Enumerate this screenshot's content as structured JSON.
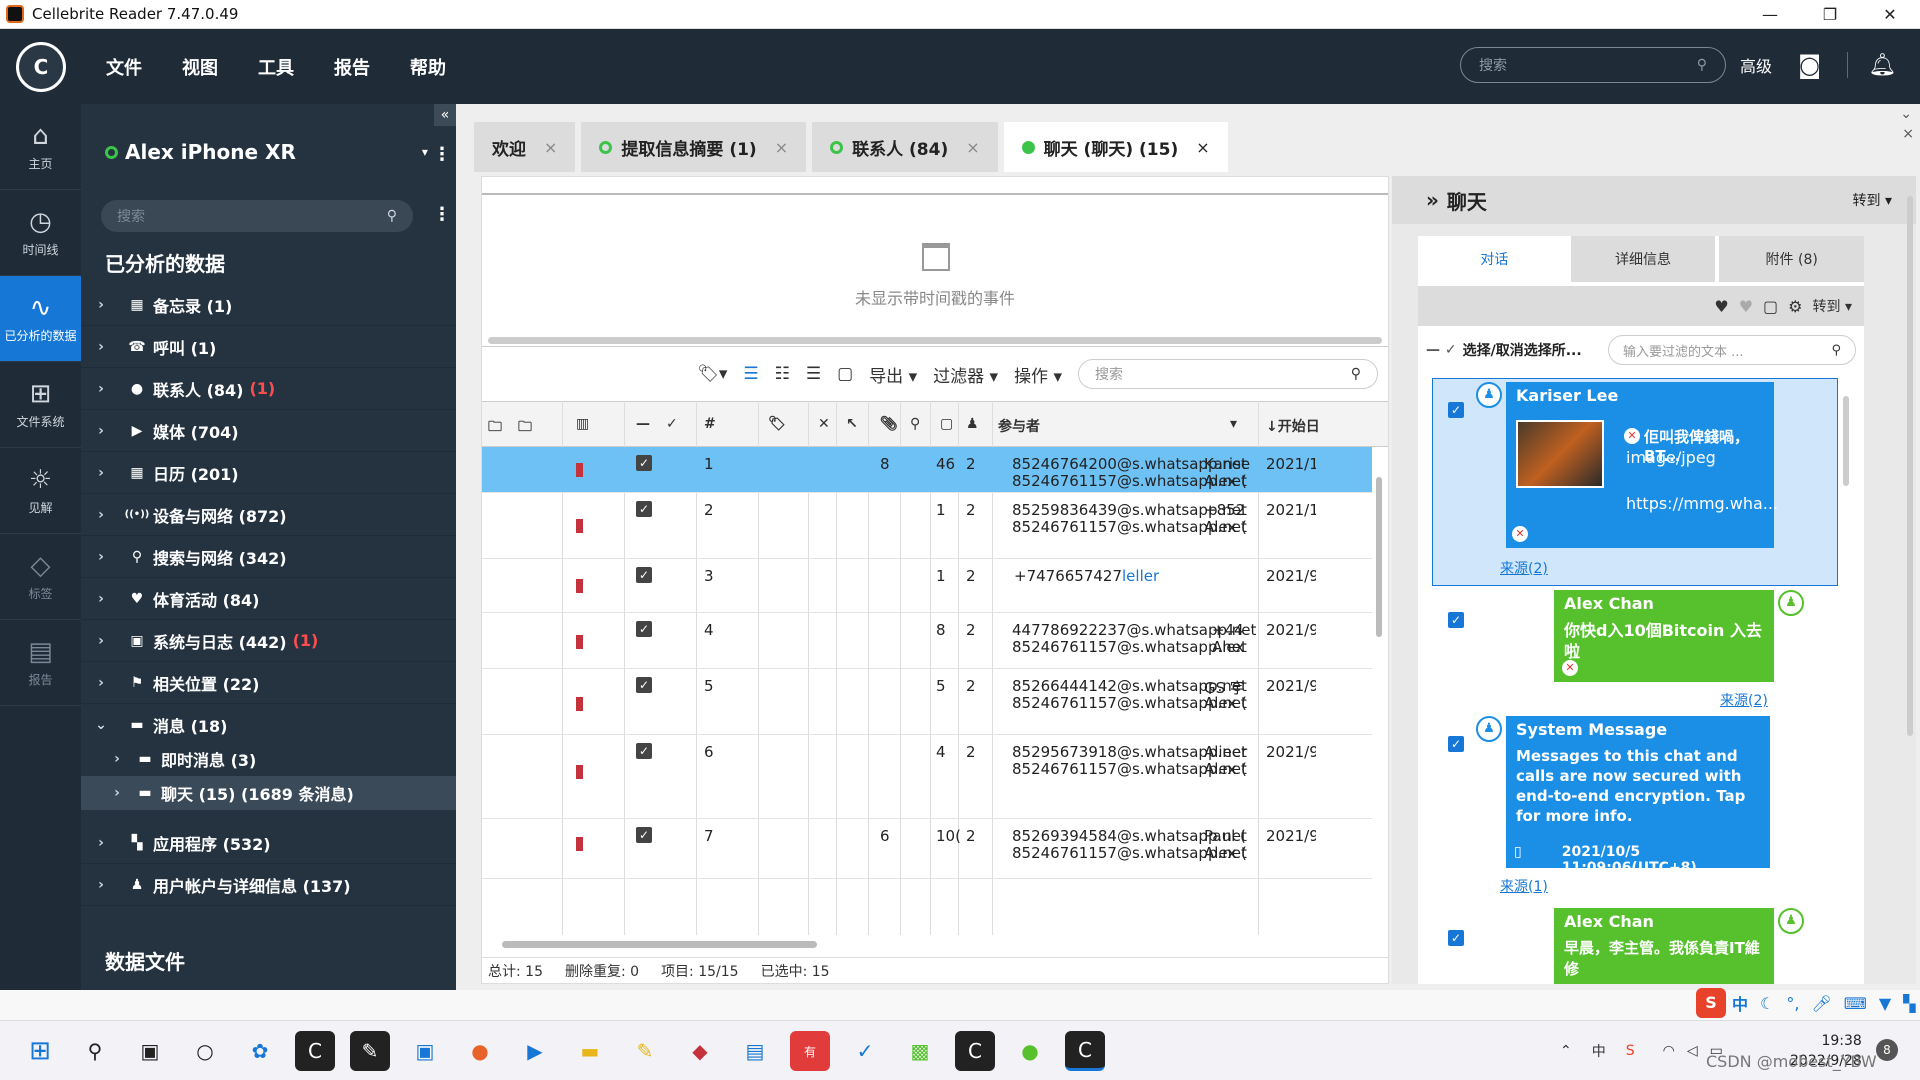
{
  "window": {
    "title": "Cellebrite Reader 7.47.0.49",
    "minimize": "—",
    "restore": "❐",
    "close": "✕"
  },
  "topbar": {
    "logo": "C",
    "menus": [
      "文件",
      "视图",
      "工具",
      "报告",
      "帮助"
    ],
    "search_placeholder": "搜索",
    "advanced": "高级"
  },
  "leftnav": [
    {
      "label": "主页",
      "icon": "⌂"
    },
    {
      "label": "时间线",
      "icon": "◷"
    },
    {
      "label": "已分析的数据",
      "icon": "∿"
    },
    {
      "label": "文件系统",
      "icon": "⊞"
    },
    {
      "label": "见解",
      "icon": "☼"
    },
    {
      "label": "标签",
      "icon": "◇"
    },
    {
      "label": "报告",
      "icon": "▤"
    }
  ],
  "tree": {
    "device": "Alex iPhone XR",
    "search_placeholder": "搜索",
    "section_title": "已分析的数据",
    "section2": "数据文件",
    "items": [
      {
        "label": "备忘录 (1)",
        "icon": "▦",
        "red": ""
      },
      {
        "label": "呼叫 (1)",
        "icon": "☎",
        "red": ""
      },
      {
        "label": "联系人 (84)",
        "icon": "●",
        "red": "(1)"
      },
      {
        "label": "媒体 (704)",
        "icon": "▶",
        "red": ""
      },
      {
        "label": "日历 (201)",
        "icon": "▦",
        "red": ""
      },
      {
        "label": "设备与网络 (872)",
        "icon": "((•))",
        "red": ""
      },
      {
        "label": "搜索与网络 (342)",
        "icon": "⚲",
        "red": ""
      },
      {
        "label": "体育活动 (84)",
        "icon": "♥",
        "red": ""
      },
      {
        "label": "系统与日志 (442)",
        "icon": "▣",
        "red": "(1)"
      },
      {
        "label": "相关位置 (22)",
        "icon": "⚑",
        "red": ""
      },
      {
        "label": "消息 (18)",
        "icon": "▬",
        "red": ""
      },
      {
        "label": "即时消息 (3)",
        "icon": "▬",
        "red": ""
      },
      {
        "label": "聊天 (15)  (1689 条消息)",
        "icon": "▬",
        "red": ""
      },
      {
        "label": "应用程序 (532)",
        "icon": "▚",
        "red": ""
      },
      {
        "label": "用户帐户与详细信息 (137)",
        "icon": "♟",
        "red": ""
      }
    ]
  },
  "tabs": [
    {
      "label": "欢迎",
      "dot": ""
    },
    {
      "label": "提取信息摘要 (1)",
      "dot": "ring"
    },
    {
      "label": "联系人 (84)",
      "dot": "ring"
    },
    {
      "label": "聊天 (聊天) (15)",
      "dot": "fill"
    }
  ],
  "tab_close": "×",
  "timeline": {
    "empty_text": "未显示带时间戳的事件"
  },
  "grid_toolbar": {
    "export": "导出 ▾",
    "filter": "过滤器 ▾",
    "actions": "操作 ▾",
    "search_placeholder": "搜索"
  },
  "grid_header": {
    "num": "#",
    "participants": "参与者",
    "start": "↓开始日"
  },
  "rows": [
    {
      "n": "1",
      "att": "8",
      "msgs": "46",
      "parts": "2",
      "p1": "85246764200@s.whatsapp.net",
      "p2": "85246761157@s.whatsapp.net",
      "n1": "Karise",
      "n2": "Alex (",
      "d": "2021/1"
    },
    {
      "n": "2",
      "att": "",
      "msgs": "1",
      "parts": "2",
      "p1": "85259836439@s.whatsapp.net",
      "p2": "85246761157@s.whatsapp.net",
      "n1": "+852",
      "n2": "Alex (",
      "d": "2021/1"
    },
    {
      "n": "3",
      "att": "",
      "msgs": "1",
      "parts": "2",
      "p1": "+7476657427",
      "p2": "",
      "n1": "leller",
      "n2": "",
      "d": "2021/9"
    },
    {
      "n": "4",
      "att": "",
      "msgs": "8",
      "parts": "2",
      "p1": "447786922237@s.whatsapp.net",
      "p2": "85246761157@s.whatsapp.net",
      "n1": "+44",
      "n2": "Alex",
      "d": "2021/9"
    },
    {
      "n": "5",
      "att": "",
      "msgs": "5",
      "parts": "2",
      "p1": "85266444142@s.whatsapp.net",
      "p2": "85246761157@s.whatsapp.net",
      "n1": "GS 宇",
      "n2": "Alex (",
      "d": "2021/9"
    },
    {
      "n": "6",
      "att": "",
      "msgs": "4",
      "parts": "2",
      "p1": "85295673918@s.whatsapp.net",
      "p2": "85246761157@s.whatsapp.net",
      "n1": "Alieer",
      "n2": "Alex (",
      "d": "2021/9"
    },
    {
      "n": "7",
      "att": "6",
      "msgs": "10(",
      "parts": "2",
      "p1": "85269394584@s.whatsapp.net",
      "p2": "85246761157@s.whatsapp.net",
      "n1": "Paul (",
      "n2": "Alex (",
      "d": "2021/9"
    }
  ],
  "status": {
    "total": "总计: 15",
    "dedup": "删除重复: 0",
    "items": "项目: 15/15",
    "selected": "已选中: 15"
  },
  "right": {
    "title": "聊天",
    "goto": "转到 ▾",
    "tabs": [
      "对话",
      "详细信息",
      "附件 (8)"
    ],
    "tools_goto": "转到 ▾",
    "select_all": "选择/取消选择所...",
    "filter_placeholder": "输入要过滤的文本 ...",
    "messages": [
      {
        "name": "Kariser Lee",
        "text": "佢叫我俾錢喎，BT...",
        "mime": "image/jpeg",
        "url": "https://mmg.wha...",
        "source": "来源(2)"
      },
      {
        "name": "Alex Chan",
        "text": "你快d入10個Bitcoin 入去啦",
        "source": "来源(2)"
      },
      {
        "name": "System Message",
        "text": "Messages to this chat and calls are now secured with end-to-end encryption. Tap for more info.",
        "time": "2021/10/5 11:09:06(UTC+8)",
        "source": "来源(1)"
      },
      {
        "name": "Alex Chan",
        "text": "早晨，李主管。我係負責IT維修"
      }
    ]
  },
  "taskbar": {
    "time": "19:38",
    "date": "2022/9/28",
    "ime": "中",
    "watermark": "CSDN @mobest_YBW"
  },
  "colors": {
    "accent": "#1677d6",
    "sidebar": "#1f2b37",
    "selected_row": "#6ec1f4",
    "green": "#56c12c",
    "red": "#ff4d4f"
  }
}
